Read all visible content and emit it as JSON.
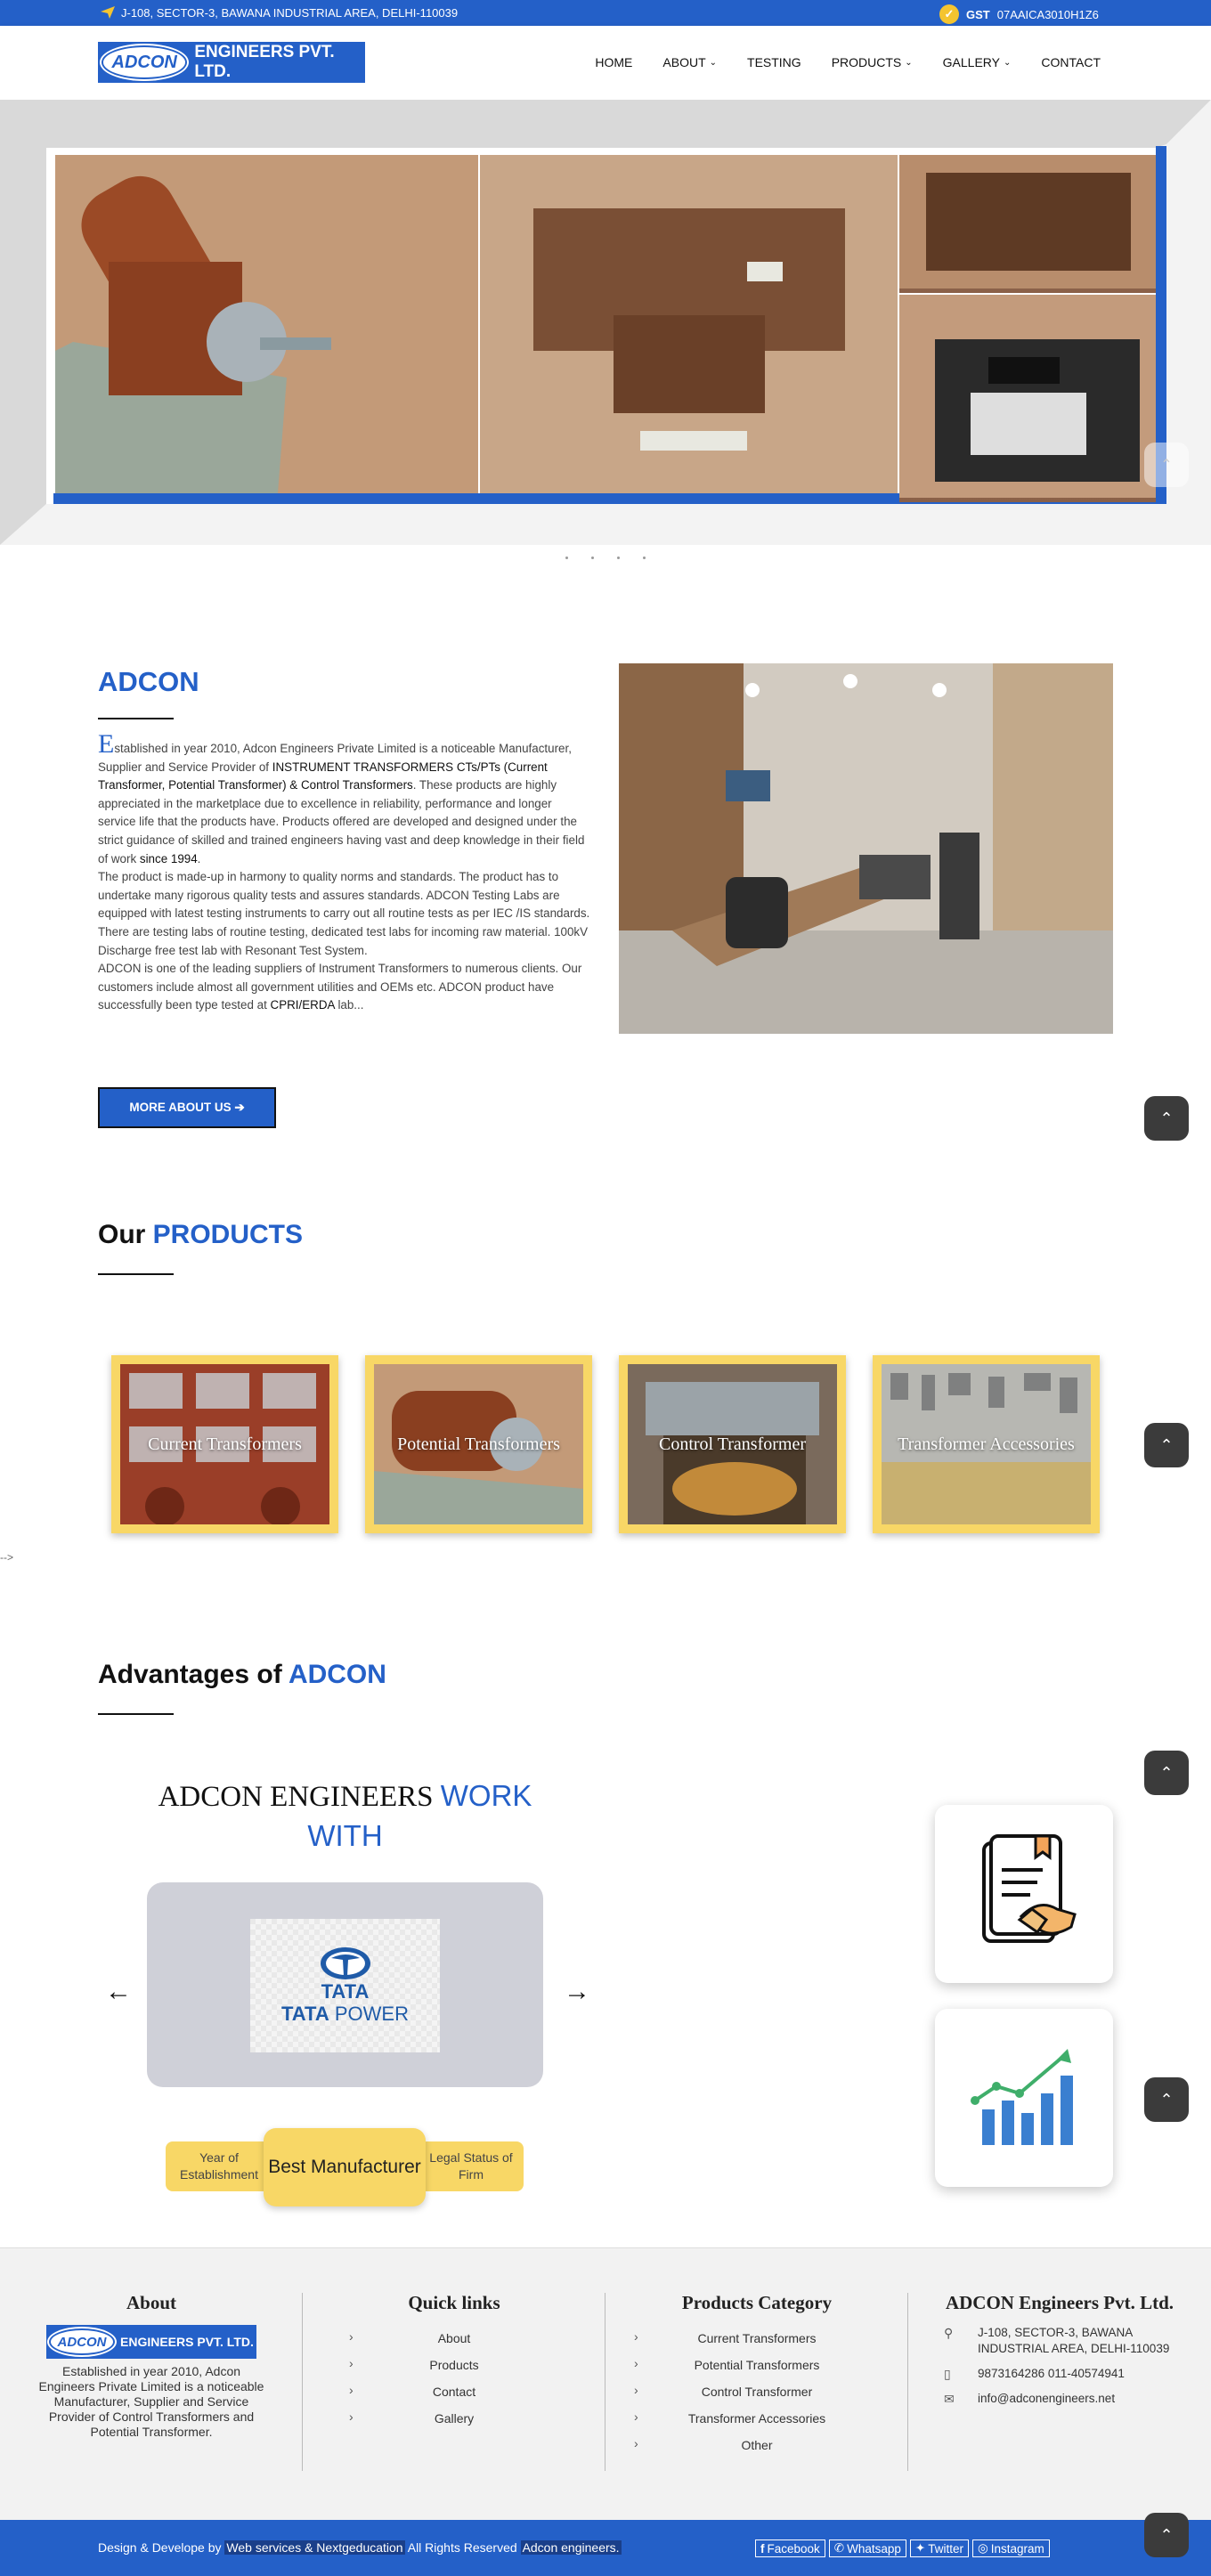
{
  "topbar": {
    "address": "J-108, SECTOR-3, BAWANA INDUSTRIAL AREA, DELHI-110039",
    "gst_label": "GST",
    "gst_number": "07AAICA3010H1Z6"
  },
  "brand": {
    "logo_word": "ADCON",
    "company": "ENGINEERS PVT. LTD."
  },
  "nav": {
    "items": [
      {
        "label": "HOME"
      },
      {
        "label": "ABOUT"
      },
      {
        "label": "TESTING"
      },
      {
        "label": "PRODUCTS"
      },
      {
        "label": "GALLERY"
      },
      {
        "label": "CONTACT"
      }
    ]
  },
  "about": {
    "title": "ADCON",
    "drop_cap": "E",
    "p1_a": "stablished in year 2010, Adcon Engineers Private Limited is a noticeable Manufacturer, Supplier and Service Provider of ",
    "p1_b": "INSTRUMENT TRANSFORMERS CTs/PTs (Current Transformer, Potential Transformer) & Control Transformers",
    "p1_c": ". These products are highly appreciated in the marketplace due to excellence in reliability, performance and longer service life that the products have. Products offered are developed and designed under the strict guidance of skilled and trained engineers having vast and deep knowledge in their field of work ",
    "p1_d": "since 1994",
    "p1_e": ".",
    "p2": "The product is made-up in harmony to quality norms and standards. The product has to undertake many rigorous quality tests and assures standards. ADCON Testing Labs are equipped with latest testing instruments to carry out all routine tests as per IEC /IS standards. There are testing labs of routine testing, dedicated test labs for incoming raw material. 100kV Discharge free test lab with Resonant Test System.",
    "p3_a": "ADCON is one of the leading suppliers of Instrument Transformers to numerous clients. Our customers include almost all government utilities and OEMs etc. ADCON product have successfully been type tested at ",
    "p3_b": "CPRI/ERDA",
    "p3_c": " lab...",
    "button": "MORE ABOUT US ➔"
  },
  "products": {
    "title_a": "Our ",
    "title_b": "PRODUCTS",
    "items": [
      {
        "label": "Current Transformers"
      },
      {
        "label": "Potential Transformers"
      },
      {
        "label": "Control Transformer"
      },
      {
        "label": "Transformer Accessories"
      }
    ],
    "stray_text": "-->"
  },
  "advantages": {
    "title_a": "Advantages of ",
    "title_b": "ADCON",
    "work_a": "ADCON ENGINEERS ",
    "work_b": "WORK WITH",
    "client_logo_text": "TATA",
    "client_logo_sub_a": "TATA",
    "client_logo_sub_b": " POWER",
    "prev": "←",
    "next": "→",
    "pills": [
      {
        "label": "Year of Establishment"
      },
      {
        "label": "Best Manufacturer"
      },
      {
        "label": "Legal Status of Firm"
      }
    ]
  },
  "footer": {
    "about_heading": "About",
    "about_text": "Established in year 2010, Adcon Engineers Private Limited is a noticeable Manufacturer, Supplier and Service Provider of Control Transformers and Potential Transformer.",
    "quick_heading": "Quick links",
    "quick_links": [
      {
        "label": "About"
      },
      {
        "label": "Products"
      },
      {
        "label": "Contact"
      },
      {
        "label": "Gallery"
      }
    ],
    "cat_heading": "Products Category",
    "categories": [
      {
        "label": "Current Transformers"
      },
      {
        "label": "Potential Transformers"
      },
      {
        "label": "Control Transformer"
      },
      {
        "label": "Transformer Accessories"
      },
      {
        "label": "Other"
      }
    ],
    "contact_heading": "ADCON Engineers Pvt. Ltd.",
    "contact_address": "J-108, SECTOR-3, BAWANA INDUSTRIAL AREA, DELHI-110039",
    "contact_phone": "9873164286 011-40574941",
    "contact_email": "info@adconengineers.net"
  },
  "bottom": {
    "credit_a": "Design & Develope by ",
    "credit_b": "Web services & Nextgeducation",
    "credit_c": " All Rights Reserved ",
    "credit_d": "Adcon engineers.",
    "social": [
      {
        "label": "Facebook"
      },
      {
        "label": "Whatsapp"
      },
      {
        "label": "Twitter"
      },
      {
        "label": "Instagram"
      }
    ]
  },
  "colors": {
    "brand_blue": "#2460c8",
    "accent_yellow": "#f8d766",
    "dark_button": "#3b3b3b"
  }
}
